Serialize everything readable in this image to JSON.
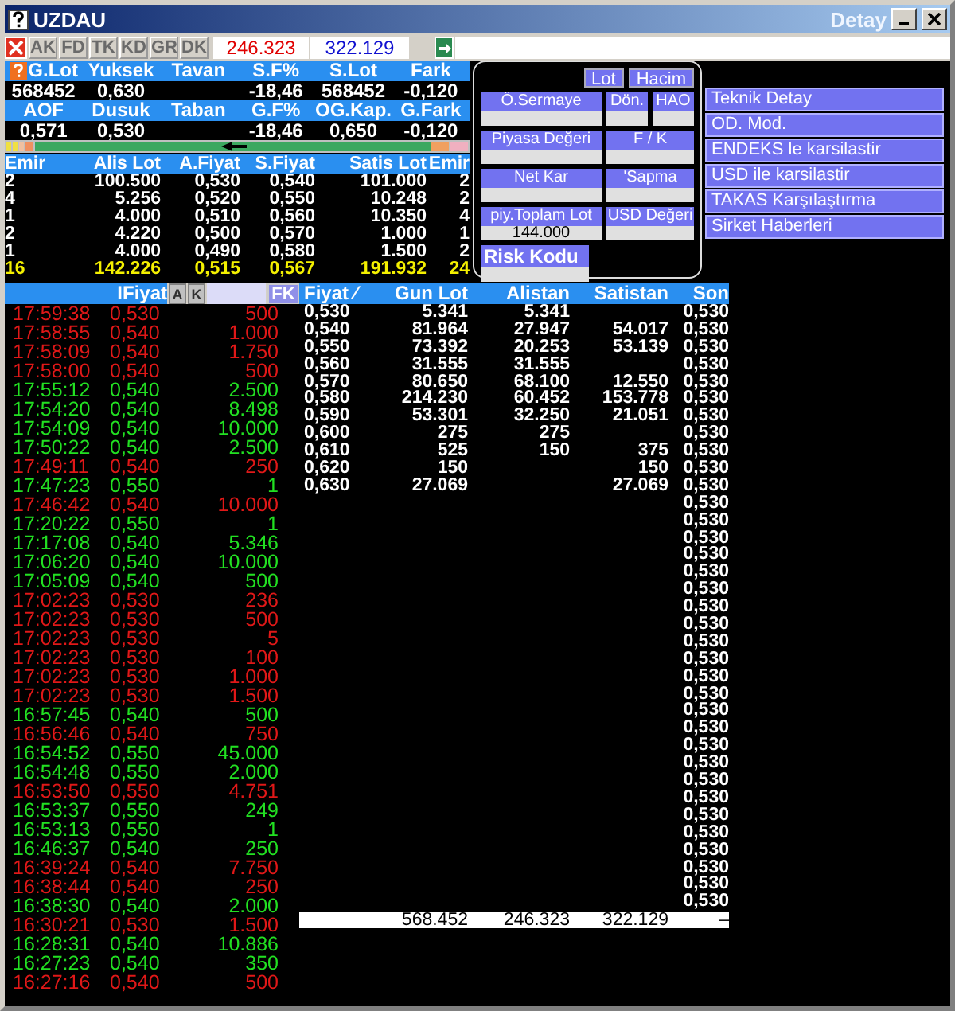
{
  "window": {
    "title": "UZDAU",
    "subtitle": "Detay"
  },
  "toolbar": {
    "buttons": [
      "AK",
      "FD",
      "TK",
      "KD",
      "GR",
      "DK"
    ],
    "sell_total": "246.323",
    "buy_total": "322.129"
  },
  "summary": [
    {
      "kind": "header",
      "cells": [
        "G.Lot",
        "Yuksek",
        "Tavan",
        "S.F%",
        "S.Lot",
        "Fark"
      ]
    },
    {
      "kind": "values",
      "cells": [
        "568452",
        "0,630",
        "",
        "-18,46",
        "568452",
        "-0,120"
      ]
    },
    {
      "kind": "header",
      "cells": [
        "AOF",
        "Dusuk",
        "Taban",
        "G.F%",
        "OG.Kap.",
        "G.Fark"
      ]
    },
    {
      "kind": "values",
      "cells": [
        "0,571",
        "0,530",
        "",
        "-18,46",
        "0,650",
        "-0,120"
      ]
    }
  ],
  "order_book": {
    "columns": [
      "Emir",
      "Alis Lot",
      "A.Fiyat",
      "S.Fiyat",
      "Satis Lot",
      "Emir"
    ],
    "rows": [
      [
        "2",
        "100.500",
        "0,530",
        "0,540",
        "101.000",
        "2"
      ],
      [
        "4",
        "5.256",
        "0,520",
        "0,550",
        "10.248",
        "2"
      ],
      [
        "1",
        "4.000",
        "0,510",
        "0,560",
        "10.350",
        "4"
      ],
      [
        "2",
        "4.220",
        "0,500",
        "0,570",
        "1.000",
        "1"
      ],
      [
        "1",
        "4.000",
        "0,490",
        "0,580",
        "1.500",
        "2"
      ]
    ],
    "total": [
      "16",
      "142.226",
      "0,515",
      "0,567",
      "191.932",
      "24"
    ]
  },
  "detail_panel": {
    "buttons": [
      "Lot",
      "Hacim"
    ],
    "field_rows": [
      {
        "fields": [
          {
            "label": "Ö.Sermaye"
          },
          {
            "label": "Dön."
          },
          {
            "label": "HAO"
          }
        ]
      },
      {
        "fields": [
          {
            "label": "Piyasa Değeri"
          },
          {
            "label": "F / K"
          }
        ]
      },
      {
        "fields": [
          {
            "label": "Net Kar"
          },
          {
            "label": "'Sapma"
          }
        ]
      },
      {
        "fields": [
          {
            "label": "piy.Toplam Lot",
            "value": "144.000"
          },
          {
            "label": "USD Değeri"
          }
        ]
      }
    ],
    "risk_label": "Risk Kodu"
  },
  "menu": [
    "Teknik Detay",
    "OD. Mod.",
    "ENDEKS le karsilastir",
    "USD ile karsilastir",
    "TAKAS Karşılaştırma",
    "Sirket Haberleri"
  ],
  "trades": {
    "header": "IFiyat",
    "sort_buttons": [
      "A",
      "K"
    ],
    "filter_button": "FK",
    "rows": [
      {
        "time": "17:59:38",
        "price": "0,530",
        "lot": "500",
        "color": "#e01818"
      },
      {
        "time": "17:58:55",
        "price": "0,540",
        "lot": "1.000",
        "color": "#e01818"
      },
      {
        "time": "17:58:09",
        "price": "0,540",
        "lot": "1.750",
        "color": "#e01818"
      },
      {
        "time": "17:58:00",
        "price": "0,540",
        "lot": "500",
        "color": "#e01818"
      },
      {
        "time": "17:55:12",
        "price": "0,540",
        "lot": "2.500",
        "color": "#22e022"
      },
      {
        "time": "17:54:20",
        "price": "0,540",
        "lot": "8.498",
        "color": "#22e022"
      },
      {
        "time": "17:54:09",
        "price": "0,540",
        "lot": "10.000",
        "color": "#22e022"
      },
      {
        "time": "17:50:22",
        "price": "0,540",
        "lot": "2.500",
        "color": "#22e022"
      },
      {
        "time": "17:49:11",
        "price": "0,540",
        "lot": "250",
        "color": "#e01818"
      },
      {
        "time": "17:47:23",
        "price": "0,550",
        "lot": "1",
        "color": "#22e022"
      },
      {
        "time": "17:46:42",
        "price": "0,540",
        "lot": "10.000",
        "color": "#e01818"
      },
      {
        "time": "17:20:22",
        "price": "0,550",
        "lot": "1",
        "color": "#22e022"
      },
      {
        "time": "17:17:08",
        "price": "0,540",
        "lot": "5.346",
        "color": "#22e022"
      },
      {
        "time": "17:06:20",
        "price": "0,540",
        "lot": "10.000",
        "color": "#22e022"
      },
      {
        "time": "17:05:09",
        "price": "0,540",
        "lot": "500",
        "color": "#22e022"
      },
      {
        "time": "17:02:23",
        "price": "0,530",
        "lot": "236",
        "color": "#e01818"
      },
      {
        "time": "17:02:23",
        "price": "0,530",
        "lot": "500",
        "color": "#e01818"
      },
      {
        "time": "17:02:23",
        "price": "0,530",
        "lot": "5",
        "color": "#e01818"
      },
      {
        "time": "17:02:23",
        "price": "0,530",
        "lot": "100",
        "color": "#e01818"
      },
      {
        "time": "17:02:23",
        "price": "0,530",
        "lot": "1.000",
        "color": "#e01818"
      },
      {
        "time": "17:02:23",
        "price": "0,530",
        "lot": "1.500",
        "color": "#e01818"
      },
      {
        "time": "16:57:45",
        "price": "0,540",
        "lot": "500",
        "color": "#22e022"
      },
      {
        "time": "16:56:46",
        "price": "0,540",
        "lot": "750",
        "color": "#e01818"
      },
      {
        "time": "16:54:52",
        "price": "0,550",
        "lot": "45.000",
        "color": "#22e022"
      },
      {
        "time": "16:54:48",
        "price": "0,550",
        "lot": "2.000",
        "color": "#22e022"
      },
      {
        "time": "16:53:50",
        "price": "0,550",
        "lot": "4.751",
        "color": "#e01818"
      },
      {
        "time": "16:53:37",
        "price": "0,550",
        "lot": "249",
        "color": "#22e022"
      },
      {
        "time": "16:53:13",
        "price": "0,550",
        "lot": "1",
        "color": "#22e022"
      },
      {
        "time": "16:46:37",
        "price": "0,540",
        "lot": "250",
        "color": "#22e022"
      },
      {
        "time": "16:39:24",
        "price": "0,540",
        "lot": "7.750",
        "color": "#e01818"
      },
      {
        "time": "16:38:44",
        "price": "0,540",
        "lot": "250",
        "color": "#e01818"
      },
      {
        "time": "16:38:30",
        "price": "0,540",
        "lot": "2.000",
        "color": "#22e022"
      },
      {
        "time": "16:30:21",
        "price": "0,530",
        "lot": "1.500",
        "color": "#e01818"
      },
      {
        "time": "16:28:31",
        "price": "0,540",
        "lot": "10.886",
        "color": "#22e022"
      },
      {
        "time": "16:27:23",
        "price": "0,540",
        "lot": "350",
        "color": "#22e022"
      },
      {
        "time": "16:27:16",
        "price": "0,540",
        "lot": "500",
        "color": "#e01818"
      }
    ]
  },
  "price_table": {
    "columns": [
      "Fiyat ∕",
      "Gun Lot",
      "Alistan",
      "Satistan",
      "Son"
    ],
    "rows": [
      {
        "fiyat": "0,530",
        "gun_lot": "5.341",
        "alistan": "5.341"
      },
      {
        "fiyat": "0,540",
        "gun_lot": "81.964",
        "alistan": "27.947",
        "satistan": "54.017"
      },
      {
        "fiyat": "0,550",
        "gun_lot": "73.392",
        "alistan": "20.253",
        "satistan": "53.139"
      },
      {
        "fiyat": "0,560",
        "gun_lot": "31.555",
        "alistan": "31.555"
      },
      {
        "fiyat": "0,570",
        "gun_lot": "80.650",
        "alistan": "68.100",
        "satistan": "12.550"
      },
      {
        "fiyat": "0,580",
        "gun_lot": "214.230",
        "alistan": "60.452",
        "satistan": "153.778"
      },
      {
        "fiyat": "0,590",
        "gun_lot": "53.301",
        "alistan": "32.250",
        "satistan": "21.051"
      },
      {
        "fiyat": "0,600",
        "gun_lot": "275",
        "alistan": "275"
      },
      {
        "fiyat": "0,610",
        "gun_lot": "525",
        "alistan": "150",
        "satistan": "375"
      },
      {
        "fiyat": "0,620",
        "gun_lot": "150",
        "satistan": "150"
      },
      {
        "fiyat": "0,630",
        "gun_lot": "27.069",
        "satistan": "27.069"
      }
    ],
    "son_column": [
      "0,530",
      "0,530",
      "0,530",
      "0,530",
      "0,530",
      "0,530",
      "0,530",
      "0,530",
      "0,530",
      "0,530",
      "0,530",
      "0,530",
      "0,530",
      "0,530",
      "0,530",
      "0,530",
      "0,530",
      "0,530",
      "0,530",
      "0,530",
      "0,530",
      "0,530",
      "0,530",
      "0,530",
      "0,530",
      "0,530",
      "0,530",
      "0,530",
      "0,530",
      "0,530",
      "0,530",
      "0,530",
      "0,530",
      "0,530",
      "0,530"
    ],
    "total": {
      "gun_lot": "568.452",
      "alistan": "246.323",
      "satistan": "322.129",
      "son": "–"
    }
  }
}
